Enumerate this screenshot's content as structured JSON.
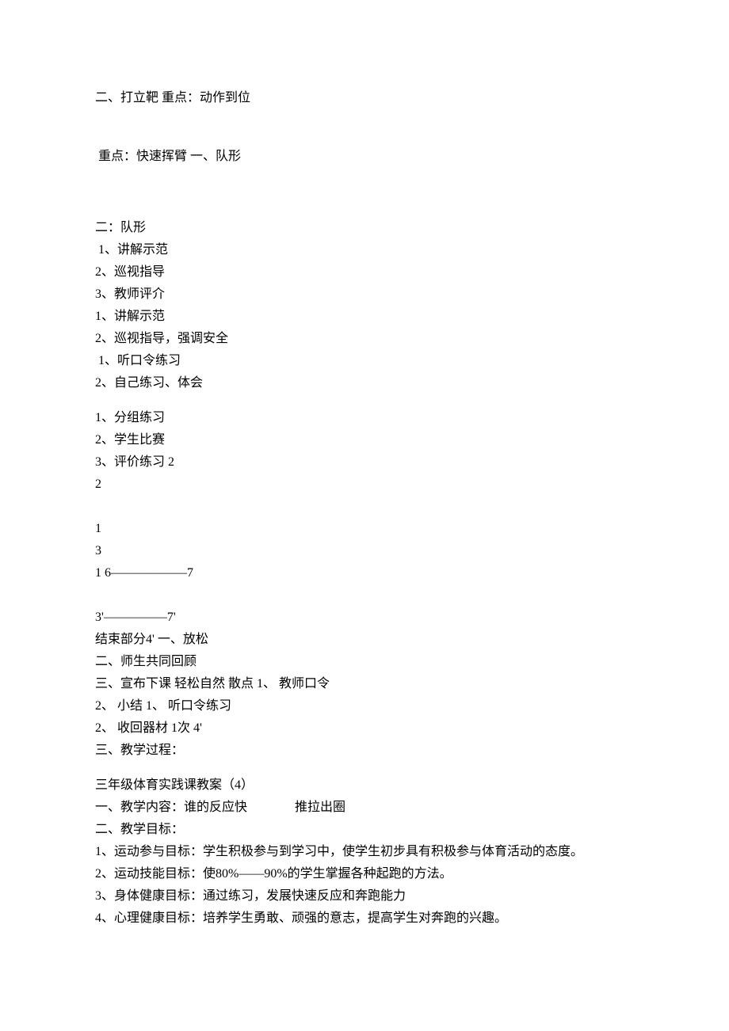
{
  "sections": {
    "p1": "二、打立靶 重点：动作到位",
    "p2": " 重点：快速挥臂 一、队形",
    "b1_h": "二：队形",
    "b1_1": " 1、讲解示范",
    "b1_2": "2、巡视指导",
    "b1_3": "3、教师评介",
    "b1_4": "1、讲解示范",
    "b1_5": "2、巡视指导，强调安全",
    "b1_6": " 1、听口令练习",
    "b1_7": "2、自己练习、体会",
    "b2_1": "1、分组练习",
    "b2_2": "2、学生比赛",
    "b2_3": "3、评价练习 2",
    "b2_4": "2",
    "b3_1": "1",
    "b3_2": "3",
    "b3_3": "1 6——————7",
    "b4_1": "3'—————7'",
    "b4_2": "结束部分4' 一、放松",
    "b4_3": "二、师生共同回顾",
    "b4_4": "三、宣布下课 轻松自然 散点 1、 教师口令",
    "b4_5": "2、 小结 1、 听口令练习",
    "b4_6": "2、 收回器材 1次 4'",
    "b4_7": "三、教学过程：",
    "b5_h": "三年级体育实践课教案（4）",
    "b5_1": "一、教学内容：谁的反应快               推拉出圈",
    "b5_2": "二、教学目标：",
    "b5_3": "1、运动参与目标：学生积极参与到学习中，使学生初步具有积极参与体育活动的态度。",
    "b5_4": "2、运动技能目标：使80%——90%的学生掌握各种起跑的方法。",
    "b5_5": "3、身体健康目标：通过练习，发展快速反应和奔跑能力",
    "b5_6": "4、心理健康目标：培养学生勇敢、顽强的意志，提高学生对奔跑的兴趣。"
  }
}
